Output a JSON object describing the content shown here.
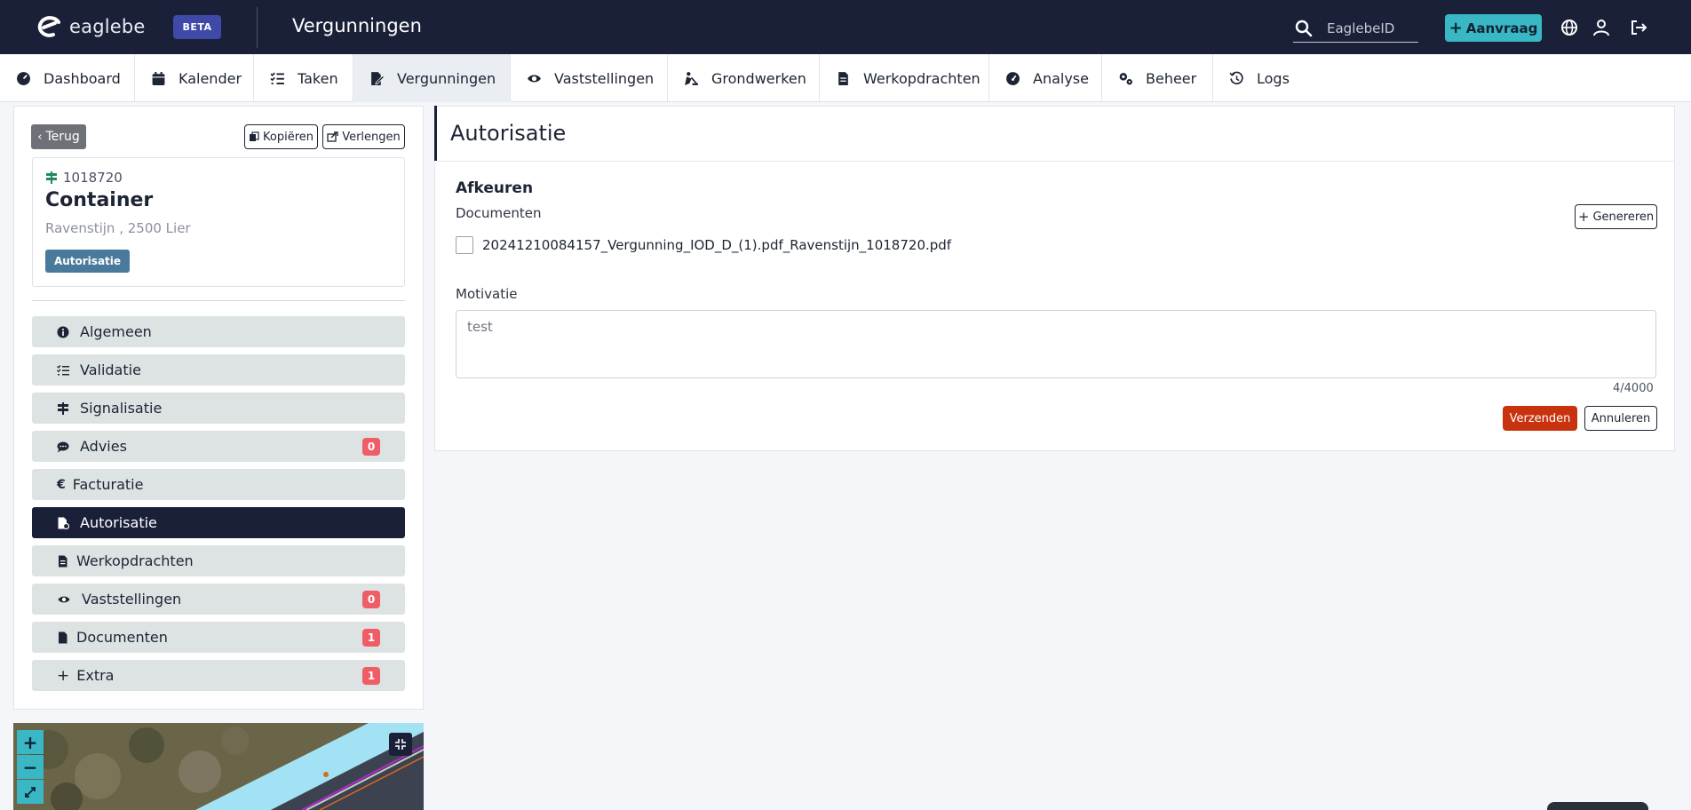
{
  "header": {
    "logo_text": "eaglebe",
    "beta_label": "BETA",
    "page_title": "Vergunningen",
    "search_value": "EaglebeID",
    "aanvraag_label": "Aanvraag"
  },
  "nav": {
    "items": [
      {
        "label": "Dashboard",
        "icon": "dashboard-icon"
      },
      {
        "label": "Kalender",
        "icon": "calendar-icon"
      },
      {
        "label": "Taken",
        "icon": "tasks-icon"
      },
      {
        "label": "Vergunningen",
        "icon": "permit-icon",
        "active": true
      },
      {
        "label": "Vaststellingen",
        "icon": "eye-icon"
      },
      {
        "label": "Grondwerken",
        "icon": "digging-icon"
      },
      {
        "label": "Werkopdrachten",
        "icon": "file-icon"
      },
      {
        "label": "Analyse",
        "icon": "gauge-icon"
      },
      {
        "label": "Beheer",
        "icon": "gears-icon"
      },
      {
        "label": "Logs",
        "icon": "history-icon"
      }
    ]
  },
  "left": {
    "back_label": "Terug",
    "copy_label": "Kopiëren",
    "extend_label": "Verlengen",
    "permit_id": "1018720",
    "permit_title": "Container",
    "address": "Ravenstijn , 2500 Lier",
    "status_badge": "Autorisatie",
    "menu": [
      {
        "label": "Algemeen",
        "icon": "info-circle-icon"
      },
      {
        "label": "Validatie",
        "icon": "checklist-icon"
      },
      {
        "label": "Signalisatie",
        "icon": "signpost-icon"
      },
      {
        "label": "Advies",
        "icon": "comment-icon",
        "badge": "0"
      },
      {
        "label": "Facturatie",
        "icon": "euro-icon"
      },
      {
        "label": "Autorisatie",
        "icon": "file-signature-icon",
        "active": true
      },
      {
        "label": "Werkopdrachten",
        "icon": "file-lines-icon"
      },
      {
        "label": "Vaststellingen",
        "icon": "eye-icon",
        "badge": "0"
      },
      {
        "label": "Documenten",
        "icon": "file-icon",
        "badge": "1"
      },
      {
        "label": "Extra",
        "icon": "plus-icon",
        "badge": "1"
      }
    ]
  },
  "map": {
    "zoom_in": "+",
    "zoom_out": "−"
  },
  "right": {
    "title": "Autorisatie",
    "section_title": "Afkeuren",
    "documents_label": "Documenten",
    "generate_label": "Genereren",
    "document_name": "20241210084157_Vergunning_IOD_D_(1).pdf_Ravenstijn_1018720.pdf",
    "motivation_label": "Motivatie",
    "motivation_value": "test",
    "char_counter": "4/4000",
    "send_label": "Verzenden",
    "cancel_label": "Annuleren"
  },
  "colors": {
    "header_bg": "#1a2038",
    "accent_teal": "#3ab7c4",
    "badge_red": "#ef5d67",
    "send_red": "#c8320f",
    "status_blue": "#4a7a9b"
  }
}
